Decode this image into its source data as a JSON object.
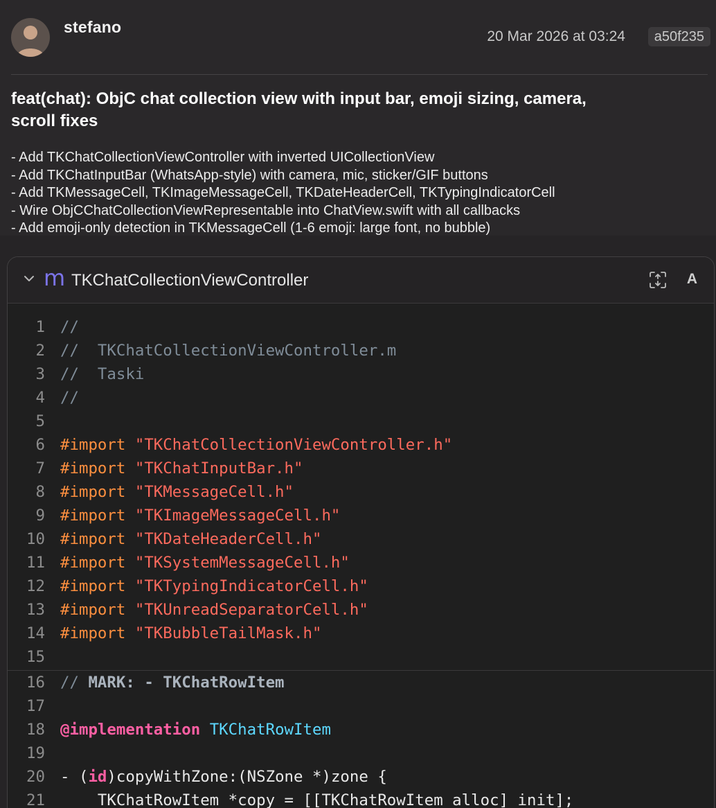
{
  "commit": {
    "author": "stefano",
    "date": "20 Mar 2026 at 03:24",
    "hash": "a50f235",
    "subject": "feat(chat): ObjC chat collection view with input bar, emoji sizing, camera,\n scroll fixes",
    "body": [
      "- Add TKChatCollectionViewController with inverted UICollectionView",
      "- Add TKChatInputBar (WhatsApp-style) with camera, mic, sticker/GIF buttons",
      "- Add TKMessageCell, TKImageMessageCell, TKDateHeaderCell, TKTypingIndicatorCell",
      "- Wire ObjCChatCollectionViewRepresentable into ChatView.swift with all callbacks",
      "- Add emoji-only detection in TKMessageCell (1-6 emoji: large font, no bubble)"
    ]
  },
  "file": {
    "type_glyph": "m",
    "name": "TKChatCollectionViewController",
    "font_toggle": "A",
    "icons": {
      "collapse": "chevron-down-icon",
      "expand": "expand-arrows-icon",
      "file_type": "objc-m-file-icon"
    }
  },
  "code_lines": [
    {
      "num": "1",
      "tokens": [
        {
          "t": "//",
          "c": "comment"
        }
      ]
    },
    {
      "num": "2",
      "tokens": [
        {
          "t": "//  TKChatCollectionViewController.m",
          "c": "comment"
        }
      ]
    },
    {
      "num": "3",
      "tokens": [
        {
          "t": "//  Taski",
          "c": "comment"
        }
      ]
    },
    {
      "num": "4",
      "tokens": [
        {
          "t": "//",
          "c": "comment"
        }
      ]
    },
    {
      "num": "5",
      "tokens": []
    },
    {
      "num": "6",
      "tokens": [
        {
          "t": "#import ",
          "c": "pre"
        },
        {
          "t": "\"TKChatCollectionViewController.h\"",
          "c": "str"
        }
      ]
    },
    {
      "num": "7",
      "tokens": [
        {
          "t": "#import ",
          "c": "pre"
        },
        {
          "t": "\"TKChatInputBar.h\"",
          "c": "str"
        }
      ]
    },
    {
      "num": "8",
      "tokens": [
        {
          "t": "#import ",
          "c": "pre"
        },
        {
          "t": "\"TKMessageCell.h\"",
          "c": "str"
        }
      ]
    },
    {
      "num": "9",
      "tokens": [
        {
          "t": "#import ",
          "c": "pre"
        },
        {
          "t": "\"TKImageMessageCell.h\"",
          "c": "str"
        }
      ]
    },
    {
      "num": "10",
      "tokens": [
        {
          "t": "#import ",
          "c": "pre"
        },
        {
          "t": "\"TKDateHeaderCell.h\"",
          "c": "str"
        }
      ]
    },
    {
      "num": "11",
      "tokens": [
        {
          "t": "#import ",
          "c": "pre"
        },
        {
          "t": "\"TKSystemMessageCell.h\"",
          "c": "str"
        }
      ]
    },
    {
      "num": "12",
      "tokens": [
        {
          "t": "#import ",
          "c": "pre"
        },
        {
          "t": "\"TKTypingIndicatorCell.h\"",
          "c": "str"
        }
      ]
    },
    {
      "num": "13",
      "tokens": [
        {
          "t": "#import ",
          "c": "pre"
        },
        {
          "t": "\"TKUnreadSeparatorCell.h\"",
          "c": "str"
        }
      ]
    },
    {
      "num": "14",
      "tokens": [
        {
          "t": "#import ",
          "c": "pre"
        },
        {
          "t": "\"TKBubbleTailMask.h\"",
          "c": "str"
        }
      ]
    },
    {
      "num": "15",
      "tokens": []
    },
    {
      "num": "16",
      "separator": true,
      "tokens": [
        {
          "t": "// ",
          "c": "comment"
        },
        {
          "t": "MARK: - TKChatRowItem",
          "c": "mark"
        }
      ]
    },
    {
      "num": "17",
      "tokens": []
    },
    {
      "num": "18",
      "tokens": [
        {
          "t": "@implementation",
          "c": "kw"
        },
        {
          "t": " "
        },
        {
          "t": "TKChatRowItem",
          "c": "cls"
        }
      ]
    },
    {
      "num": "19",
      "tokens": []
    },
    {
      "num": "20",
      "tokens": [
        {
          "t": "- ("
        },
        {
          "t": "id",
          "c": "kw"
        },
        {
          "t": ")copyWithZone:(NSZone *)zone {"
        }
      ]
    },
    {
      "num": "21",
      "tokens": [
        {
          "t": "    TKChatRowItem *copy = [[TKChatRowItem alloc] init];"
        }
      ]
    }
  ]
}
